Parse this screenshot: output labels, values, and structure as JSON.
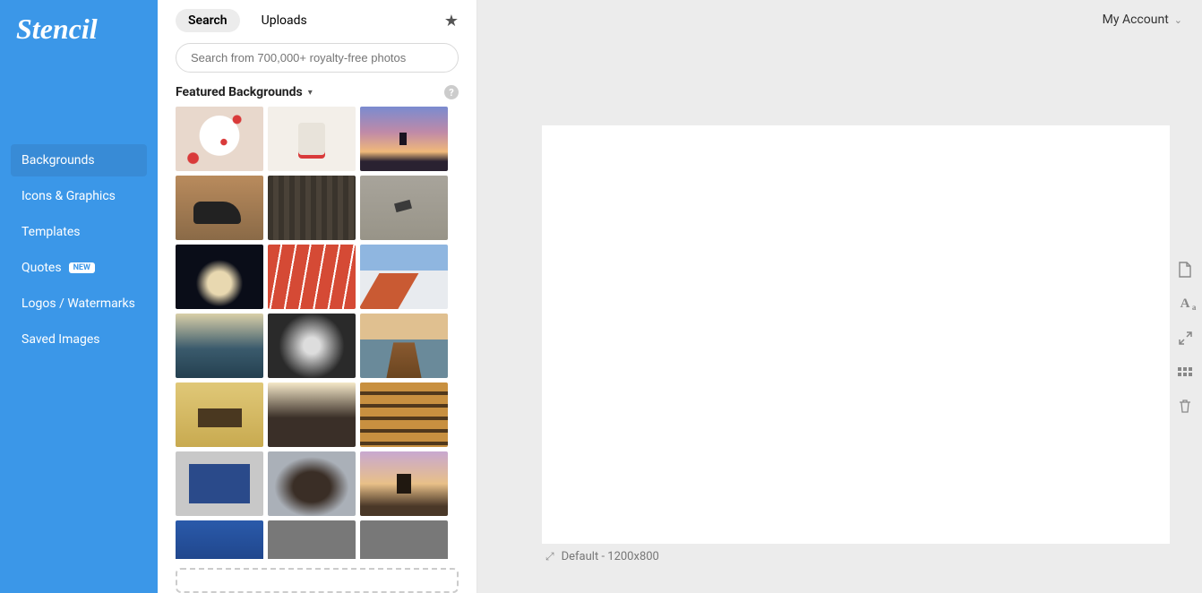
{
  "brand": "Stencil",
  "sidebar": {
    "items": [
      {
        "label": "Backgrounds",
        "active": true
      },
      {
        "label": "Icons & Graphics"
      },
      {
        "label": "Templates"
      },
      {
        "label": "Quotes",
        "badge": "NEW"
      },
      {
        "label": "Logos / Watermarks"
      },
      {
        "label": "Saved Images"
      }
    ]
  },
  "library": {
    "tabs": {
      "search": "Search",
      "uploads": "Uploads"
    },
    "search_placeholder": "Search from 700,000+ royalty-free photos",
    "section_title": "Featured Backgrounds"
  },
  "canvas": {
    "label_prefix": "Default",
    "dimensions": "1200x800"
  },
  "account": {
    "label": "My Account"
  }
}
